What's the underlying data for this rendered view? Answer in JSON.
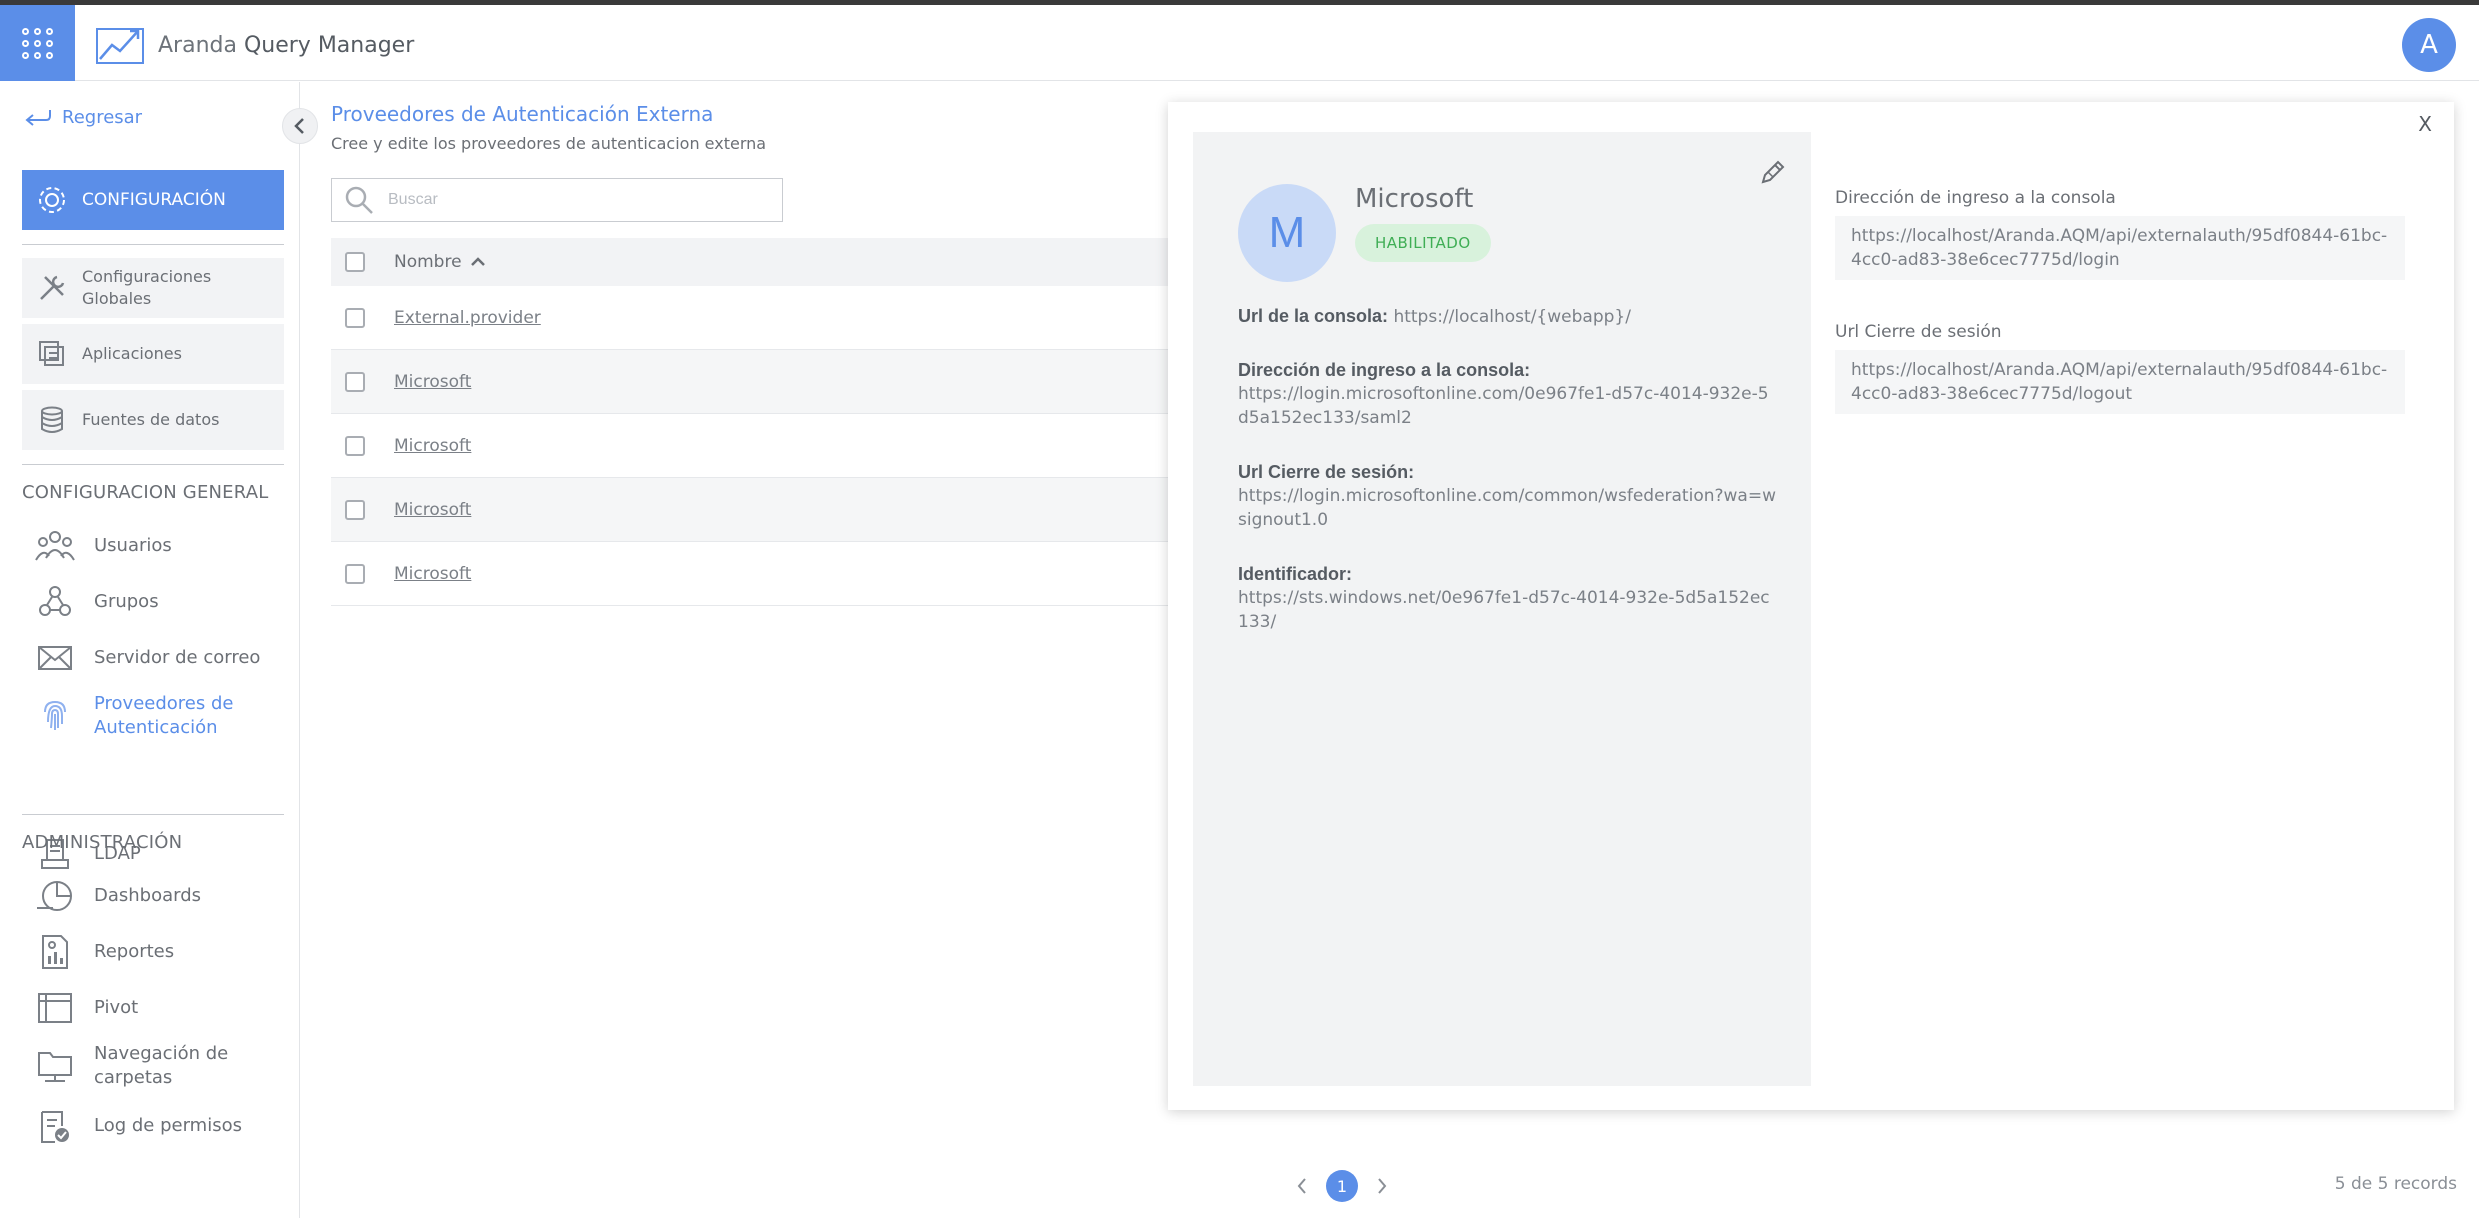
{
  "app": {
    "name_light": "Aranda",
    "name_bold": "Query Manager",
    "user_initial": "A"
  },
  "sidebar": {
    "back_label": "Regresar",
    "config_label": "CONFIGURACIÓN",
    "sub_items": [
      {
        "label": "Configuraciones Globales",
        "icon": "tools-icon"
      },
      {
        "label": "Aplicaciones",
        "icon": "applications-icon"
      },
      {
        "label": "Fuentes de datos",
        "icon": "database-icon"
      }
    ],
    "general_title": "CONFIGURACION GENERAL",
    "general_items": [
      {
        "label": "Usuarios",
        "icon": "users-icon"
      },
      {
        "label": "Grupos",
        "icon": "groups-icon"
      },
      {
        "label": "Servidor de correo",
        "icon": "mail-icon"
      },
      {
        "label": "Proveedores de Autenticación",
        "icon": "fingerprint-icon"
      },
      {
        "label": "LDAP",
        "icon": "ldap-icon"
      }
    ],
    "admin_title": "ADMINISTRACIÓN",
    "admin_items": [
      {
        "label": "Dashboards",
        "icon": "dashboard-icon"
      },
      {
        "label": "Reportes",
        "icon": "reports-icon"
      },
      {
        "label": "Pivot",
        "icon": "pivot-icon"
      },
      {
        "label": "Navegación de carpetas",
        "icon": "folder-icon"
      },
      {
        "label": "Log de permisos",
        "icon": "permissions-log-icon"
      }
    ]
  },
  "main": {
    "title": "Proveedores de Autenticación Externa",
    "subtitle": "Cree y edite los proveedores de autenticacion externa",
    "search_placeholder": "Buscar",
    "column_name": "Nombre",
    "rows": [
      "External.provider",
      "Microsoft",
      "Microsoft",
      "Microsoft",
      "Microsoft"
    ],
    "pagination": {
      "current_page": "1",
      "records": "5 de 5 records"
    }
  },
  "detail": {
    "close_label": "X",
    "avatar_letter": "M",
    "name": "Microsoft",
    "status": "HABILITADO",
    "console_url_label": "Url de la consola:",
    "console_url": "https://localhost/{webapp}/",
    "login_label": "Dirección de ingreso a la consola:",
    "login_value": "https://login.microsoftonline.com/0e967fe1-d57c-4014-932e-5d5a152ec133/saml2",
    "logout_label": "Url Cierre de sesión:",
    "logout_value": "https://login.microsoftonline.com/common/wsfederation?wa=wsignout1.0",
    "identifier_label": "Identificador:",
    "identifier_value": "https://sts.windows.net/0e967fe1-d57c-4014-932e-5d5a152ec133/",
    "right_login_label": "Dirección de ingreso a la consola",
    "right_login_value": "https://localhost/Aranda.AQM/api/externalauth/95df0844-61bc-4cc0-ad83-38e6cec7775d/login",
    "right_logout_label": "Url Cierre de sesión",
    "right_logout_value": "https://localhost/Aranda.AQM/api/externalauth/95df0844-61bc-4cc0-ad83-38e6cec7775d/logout"
  },
  "colors": {
    "accent": "#5b8ee8",
    "badge_bg": "#d8f2dc",
    "badge_text": "#3fae55"
  }
}
